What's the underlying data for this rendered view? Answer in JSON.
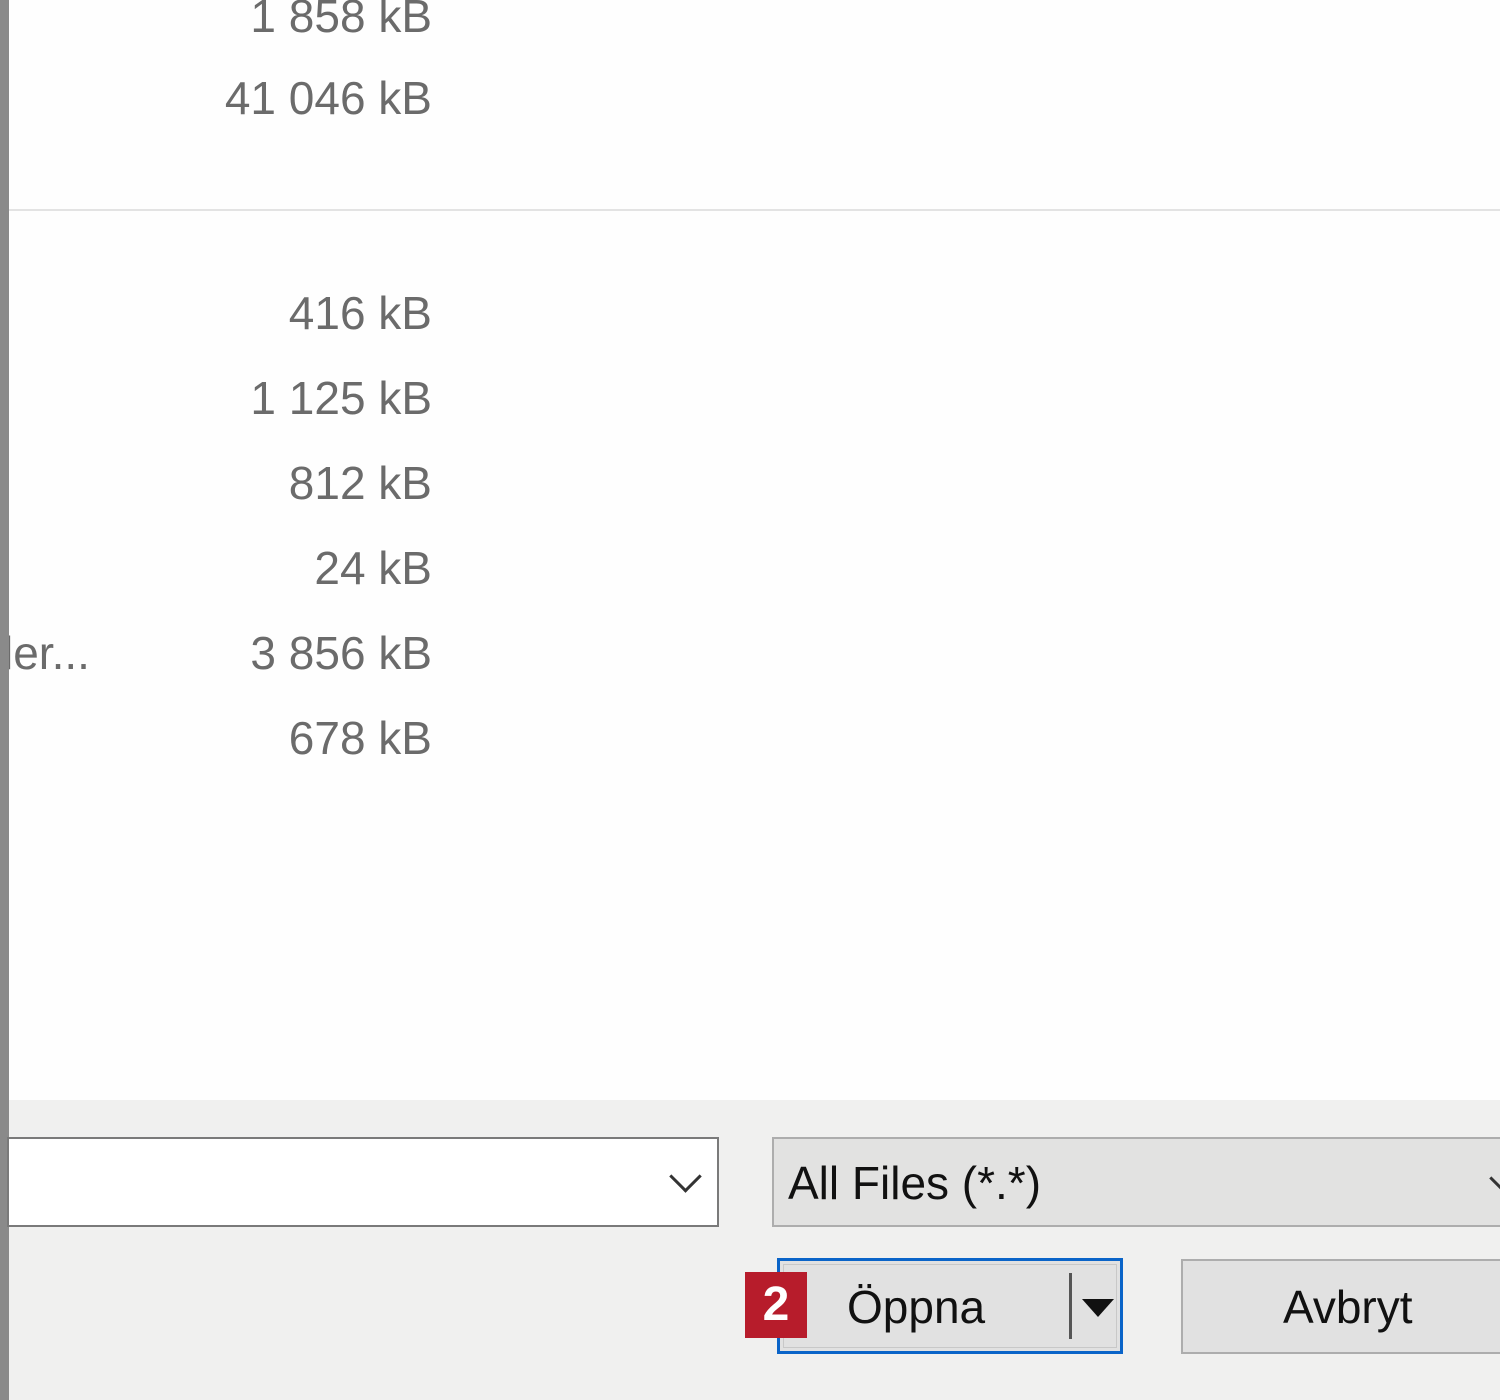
{
  "file_list": {
    "rows_group1": [
      {
        "size": "1 858 kB"
      },
      {
        "size": "41 046 kB"
      }
    ],
    "rows_group2": [
      {
        "size": "416 kB"
      },
      {
        "size": "1 125 kB"
      },
      {
        "size": "812 kB"
      },
      {
        "size": "24 kB"
      },
      {
        "size": "3 856 kB",
        "name_fragment": "ler..."
      },
      {
        "size": "678 kB"
      }
    ]
  },
  "footer": {
    "filename_value": "",
    "filetype_selected": "All Files (*.*)",
    "open_label": "Öppna",
    "cancel_label": "Avbryt",
    "step_badge": "2"
  },
  "colors": {
    "accent": "#0a64c8",
    "badge": "#b71c2b"
  }
}
